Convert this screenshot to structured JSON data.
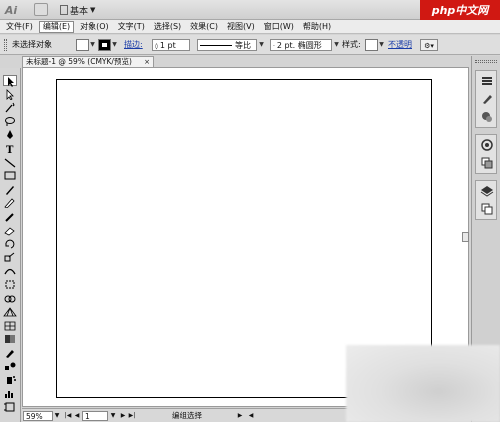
{
  "app_bar": {
    "workspace_label": "基本",
    "logo_icon": "ai-logo-icon",
    "bridge_icon": "bridge-icon",
    "watermark": "php中文网"
  },
  "menu": {
    "items": [
      {
        "label": "文件(F)",
        "active": false
      },
      {
        "label": "编辑(E)",
        "active": true
      },
      {
        "label": "对象(O)",
        "active": false
      },
      {
        "label": "文字(T)",
        "active": false
      },
      {
        "label": "选择(S)",
        "active": false
      },
      {
        "label": "效果(C)",
        "active": false
      },
      {
        "label": "视图(V)",
        "active": false
      },
      {
        "label": "窗口(W)",
        "active": false
      },
      {
        "label": "帮助(H)",
        "active": false
      }
    ]
  },
  "control": {
    "no_selection": "未选择对象",
    "stroke_label": "描边:",
    "stroke_weight": "1 pt",
    "profile_label": "等比",
    "brush_label": "2 pt. 椭圆形",
    "style_label": "样式:",
    "opacity_link": "不透明"
  },
  "document": {
    "tab_title": "未标题-1 @ 59% (CMYK/预览)",
    "close": "×"
  },
  "status": {
    "zoom": "59%",
    "page": "1",
    "tool_status": "编组选择"
  },
  "colors": {
    "artboard_border": "#000000",
    "canvas_bg": "#ffffff",
    "chrome_bg": "#d4d4d4",
    "watermark_bg": "#d01812"
  },
  "tools": [
    {
      "name": "selection-tool-icon",
      "selected": true
    },
    {
      "name": "direct-selection-tool-icon",
      "selected": false
    },
    {
      "name": "magic-wand-tool-icon",
      "selected": false
    },
    {
      "name": "lasso-tool-icon",
      "selected": false
    },
    {
      "name": "pen-tool-icon",
      "selected": false
    },
    {
      "name": "type-tool-icon",
      "selected": false
    },
    {
      "name": "line-segment-tool-icon",
      "selected": false
    },
    {
      "name": "rectangle-tool-icon",
      "selected": false
    },
    {
      "name": "paintbrush-tool-icon",
      "selected": false
    },
    {
      "name": "pencil-tool-icon",
      "selected": false
    },
    {
      "name": "blob-brush-tool-icon",
      "selected": false
    },
    {
      "name": "eraser-tool-icon",
      "selected": false
    },
    {
      "name": "rotate-tool-icon",
      "selected": false
    },
    {
      "name": "scale-tool-icon",
      "selected": false
    },
    {
      "name": "warp-tool-icon",
      "selected": false
    },
    {
      "name": "free-transform-tool-icon",
      "selected": false
    },
    {
      "name": "shape-builder-tool-icon",
      "selected": false
    },
    {
      "name": "perspective-grid-tool-icon",
      "selected": false
    },
    {
      "name": "mesh-tool-icon",
      "selected": false
    },
    {
      "name": "gradient-tool-icon",
      "selected": false
    },
    {
      "name": "eyedropper-tool-icon",
      "selected": false
    },
    {
      "name": "blend-tool-icon",
      "selected": false
    },
    {
      "name": "symbol-sprayer-tool-icon",
      "selected": false
    },
    {
      "name": "column-graph-tool-icon",
      "selected": false
    },
    {
      "name": "artboard-tool-icon",
      "selected": false
    }
  ]
}
